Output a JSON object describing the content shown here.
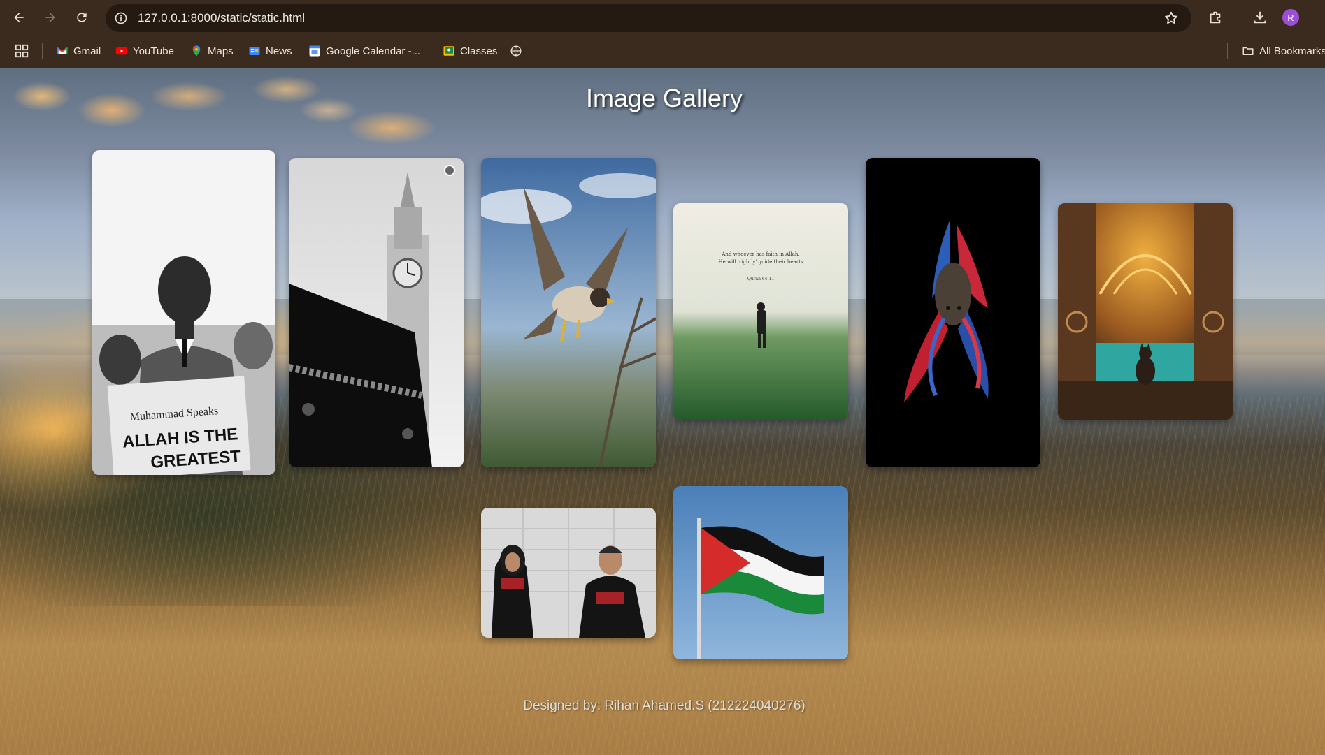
{
  "browser": {
    "url": "127.0.0.1:8000/static/static.html",
    "profile_initial": "R",
    "bookmarks": [
      {
        "label": "Gmail",
        "icon": "gmail-icon"
      },
      {
        "label": "YouTube",
        "icon": "youtube-icon"
      },
      {
        "label": "Maps",
        "icon": "maps-icon"
      },
      {
        "label": "News",
        "icon": "news-icon"
      },
      {
        "label": "Google Calendar -...",
        "icon": "calendar-icon"
      },
      {
        "label": "Classes",
        "icon": "classroom-icon"
      }
    ],
    "all_bookmarks_label": "All Bookmarks"
  },
  "page": {
    "title": "Image Gallery",
    "footer": "Designed by: Rihan Ahamed.S (212224040276)"
  },
  "gallery": {
    "images": [
      {
        "name": "boxer-newspaper-photo"
      },
      {
        "name": "kaaba-clock-tower-photo"
      },
      {
        "name": "falcon-photo"
      },
      {
        "name": "quran-verse-field-photo",
        "caption_lines": [
          "And whoever has faith in Allah,",
          "He will 'rightly' guide their hearts",
          "Quran 64:11"
        ]
      },
      {
        "name": "betta-fish-photo"
      },
      {
        "name": "mosque-interior-cat-photo"
      },
      {
        "name": "fighters-portrait-photo"
      },
      {
        "name": "palestine-flag-photo"
      }
    ],
    "newspaper_text": [
      "Muhammad Speaks",
      "ALLAH IS THE",
      "GREATEST"
    ]
  },
  "colors": {
    "chrome_bg": "#3b2b1f",
    "omnibox_bg": "#241a12",
    "avatar": "#9b4fd6"
  }
}
